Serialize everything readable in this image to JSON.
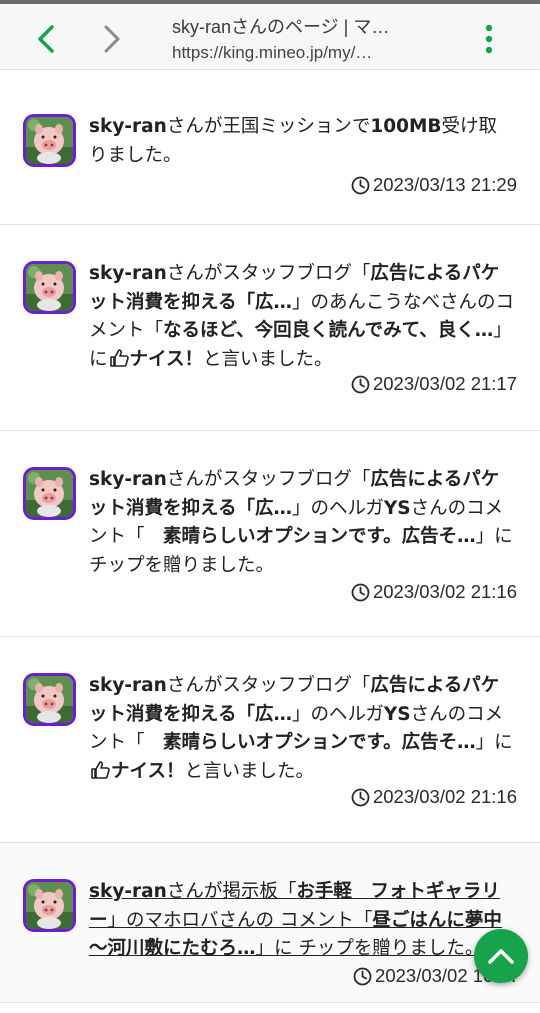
{
  "browser": {
    "page_title": "sky-ranさんのページ | マ…",
    "url": "https://king.mineo.jp/my/…",
    "accent": "#16a34a"
  },
  "feed": [
    {
      "parts": [
        {
          "t": "b",
          "text": "sky-ran"
        },
        {
          "t": "n",
          "text": "さんが王国ミッションで"
        },
        {
          "t": "b",
          "text": "100MB"
        },
        {
          "t": "n",
          "text": "受け取りました。"
        }
      ],
      "timestamp": "2023/03/13 21:29"
    },
    {
      "parts": [
        {
          "t": "b",
          "text": "sky-ran"
        },
        {
          "t": "n",
          "text": "さんがスタッフブログ「"
        },
        {
          "t": "b",
          "text": "広告によるパケット消費を抑える「広…"
        },
        {
          "t": "n",
          "text": "」のあんこうなべさんのコメント「"
        },
        {
          "t": "b",
          "text": "なるほど、今回良く読んでみて、良く…"
        },
        {
          "t": "n",
          "text": "」に"
        },
        {
          "t": "thumb"
        },
        {
          "t": "b",
          "text": "ナイス！"
        },
        {
          "t": "n",
          "text": "と言いました。"
        }
      ],
      "timestamp": "2023/03/02 21:17"
    },
    {
      "parts": [
        {
          "t": "b",
          "text": "sky-ran"
        },
        {
          "t": "n",
          "text": "さんがスタッフブログ「"
        },
        {
          "t": "b",
          "text": "広告によるパケット消費を抑える「広…"
        },
        {
          "t": "n",
          "text": "」のヘルガ"
        },
        {
          "t": "b",
          "text": "YS"
        },
        {
          "t": "n",
          "text": "さんのコメント「　"
        },
        {
          "t": "b",
          "text": "素晴らしいオプションです。広告そ…"
        },
        {
          "t": "n",
          "text": "」にチップを贈りました。"
        }
      ],
      "timestamp": "2023/03/02 21:16"
    },
    {
      "parts": [
        {
          "t": "b",
          "text": "sky-ran"
        },
        {
          "t": "n",
          "text": "さんがスタッフブログ「"
        },
        {
          "t": "b",
          "text": "広告によるパケット消費を抑える「広…"
        },
        {
          "t": "n",
          "text": "」のヘルガ"
        },
        {
          "t": "b",
          "text": "YS"
        },
        {
          "t": "n",
          "text": "さんのコメント「　"
        },
        {
          "t": "b",
          "text": "素晴らしいオプションです。広告そ…"
        },
        {
          "t": "n",
          "text": "」に"
        },
        {
          "t": "thumb"
        },
        {
          "t": "b",
          "text": "ナイス！"
        },
        {
          "t": "n",
          "text": "と言いました。"
        }
      ],
      "timestamp": "2023/03/02 21:16"
    },
    {
      "linked": true,
      "parts": [
        {
          "t": "b",
          "text": "sky-ran"
        },
        {
          "t": "n",
          "text": "さんが掲示板「"
        },
        {
          "t": "b",
          "text": "お手軽　フォトギャラリー"
        },
        {
          "t": "n",
          "text": "」のマホロバさんの コメント「"
        },
        {
          "t": "b",
          "text": "昼ごはんに夢中～河川敷にたむろ…"
        },
        {
          "t": "n",
          "text": "」に チップを贈りました。"
        }
      ],
      "timestamp": "2023/03/02 10:…"
    }
  ]
}
